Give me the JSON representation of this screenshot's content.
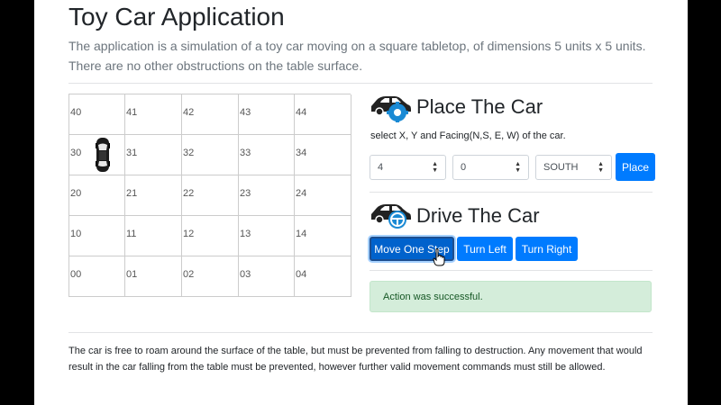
{
  "header": {
    "title": "Toy Car Application",
    "intro": "The application is a simulation of a toy car moving on a square tabletop, of dimensions 5 units x 5 units. There are no other obstructions on the table surface."
  },
  "board": {
    "rows": [
      [
        "40",
        "41",
        "42",
        "43",
        "44"
      ],
      [
        "30",
        "31",
        "32",
        "33",
        "34"
      ],
      [
        "20",
        "21",
        "22",
        "23",
        "24"
      ],
      [
        "10",
        "11",
        "12",
        "13",
        "14"
      ],
      [
        "00",
        "01",
        "02",
        "03",
        "04"
      ]
    ],
    "car": {
      "row": 1,
      "col": 0,
      "icon": "car-top-view-icon"
    }
  },
  "place": {
    "title": "Place The Car",
    "icon": "car-gear-icon",
    "helper": "select X, Y and Facing(N,S, E, W) of the car.",
    "x_value": "4",
    "y_value": "0",
    "facing_value": "SOUTH",
    "button_label": "Place"
  },
  "drive": {
    "title": "Drive The Car",
    "icon": "car-steering-wheel-icon",
    "buttons": {
      "move": "Move One Step",
      "left": "Turn Left",
      "right": "Turn Right"
    }
  },
  "alert": {
    "message": "Action was successful."
  },
  "footer": {
    "text": "The car is free to roam around the surface of the table, but must be prevented from falling to destruction. Any movement that would result in the car falling from the table must be prevented, however further valid movement commands must still be allowed."
  },
  "colors": {
    "primary": "#007bff",
    "primary_active": "#0062cc",
    "alert_bg": "#d4edda",
    "alert_text": "#155724",
    "icon_blue": "#1a8ad4"
  }
}
